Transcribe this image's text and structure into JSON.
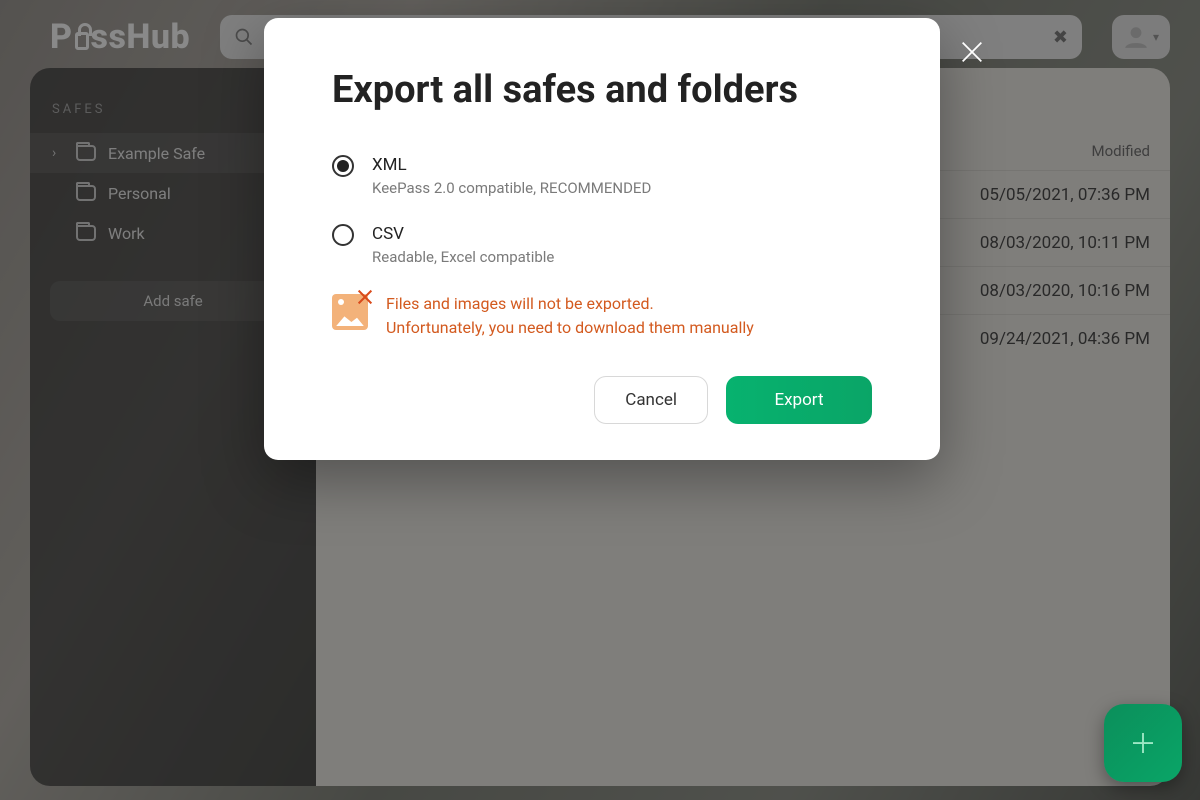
{
  "brand": {
    "name_a": "P",
    "name_b": "ssHub"
  },
  "search": {
    "value": ""
  },
  "sidebar": {
    "heading": "SAFES",
    "items": [
      {
        "label": "Example Safe",
        "selected": true,
        "expandable": true
      },
      {
        "label": "Personal",
        "selected": false,
        "expandable": false
      },
      {
        "label": "Work",
        "selected": false,
        "expandable": false
      }
    ],
    "add_label": "Add safe"
  },
  "content": {
    "columns": {
      "modified": "Modified"
    },
    "rows": [
      {
        "modified": "05/05/2021, 07:36 PM"
      },
      {
        "modified": "08/03/2020, 10:11 PM"
      },
      {
        "modified": "08/03/2020, 10:16 PM"
      },
      {
        "modified": "09/24/2021, 04:36 PM"
      }
    ]
  },
  "modal": {
    "title": "Export all safes and folders",
    "options": [
      {
        "label": "XML",
        "sub": "KeePass 2.0 compatible, RECOMMENDED",
        "selected": true
      },
      {
        "label": "CSV",
        "sub": "Readable, Excel compatible",
        "selected": false
      }
    ],
    "warning_line1": "Files and images will not be exported.",
    "warning_line2": "Unfortunately, you need to download them manually",
    "cancel": "Cancel",
    "confirm": "Export"
  }
}
